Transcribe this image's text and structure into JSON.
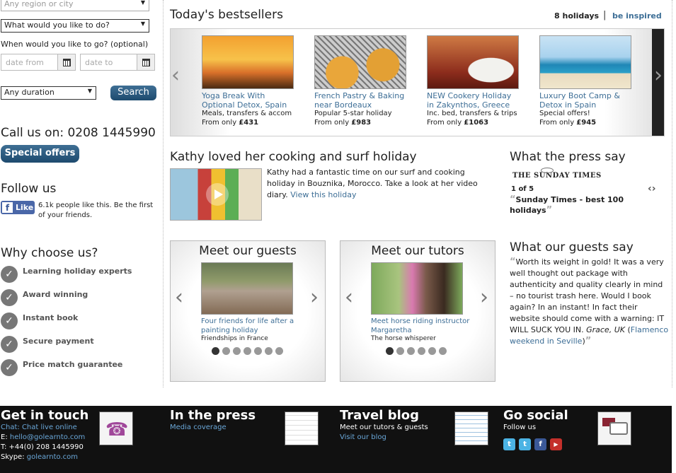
{
  "search": {
    "region_placeholder": "Any region or city",
    "what_label": "What would you like to do?",
    "when_label": "When would you like to go? (optional)",
    "date_from_placeholder": "date from",
    "date_to_placeholder": "date to",
    "duration": "Any duration",
    "search_button": "Search"
  },
  "sidebar": {
    "call_us": "Call us on: 0208 1445990",
    "special_offers": "Special offers",
    "follow_us": "Follow us",
    "like_button": "Like",
    "like_text": "6.1k people like this. Be the first of your friends.",
    "why_title": "Why choose us?",
    "why_items": [
      "Learning holiday experts",
      "Award winning",
      "Instant book",
      "Secure payment",
      "Price match guarantee"
    ]
  },
  "bestsellers": {
    "title": "Today's bestsellers",
    "count": "8 holidays",
    "inspired_link": "be inspired",
    "cards": [
      {
        "title": "Yoga Break With Optional Detox, Spain",
        "desc": "Meals, transfers & accom",
        "price_prefix": "From only ",
        "price": "£431",
        "image": "yoga-photo"
      },
      {
        "title": "French Pastry & Baking near Bordeaux",
        "desc": "Popular 5-star holiday",
        "price_prefix": "From only ",
        "price": "£983",
        "image": "pastry-photo"
      },
      {
        "title": "NEW Cookery Holiday in Zakynthos, Greece",
        "desc": "Inc. bed, transfers & trips",
        "price_prefix": "From only ",
        "price": "£1063",
        "image": "cookery-photo"
      },
      {
        "title": "Luxury Boot Camp & Detox in Spain",
        "desc": "Special offers!",
        "price_prefix": "From only ",
        "price": "£945",
        "image": "bootcamp-photo"
      }
    ]
  },
  "feature": {
    "title": "Kathy loved her cooking and surf holiday",
    "text": "Kathy had a fantastic time on our surf and cooking holiday in Bouznika, Morocco. Take a look at her video diary.",
    "link": "View this holiday"
  },
  "press": {
    "title": "What the press say",
    "logo": "THE SUNDAY TIMES",
    "counter": "1 of 5",
    "quote": "Sunday Times - best 100 holidays"
  },
  "guests": {
    "title": "Meet our guests",
    "link": "Four friends for life after a painting holiday",
    "sub": "Friendships in France"
  },
  "tutors": {
    "title": "Meet our tutors",
    "link": "Meet horse riding instructor Margaretha",
    "sub": "The horse whisperer"
  },
  "testimonial": {
    "title": "What our guests say",
    "text": "Worth its weight in gold! It was a very well thought out package with authenticity and quality clearly in mind – no tourist trash here. Would I book again? In an instant! In fact their website should come with a warning: IT WILL SUCK YOU IN.",
    "author": "Grace, UK",
    "holiday": "Flamenco weekend in Seville"
  },
  "footer": {
    "contact": {
      "title": "Get in touch",
      "chat_label": "Chat:",
      "chat_link": "Chat live online",
      "email_label": "E:",
      "email": "hello@golearnto.com",
      "phone": "T: +44(0) 208 1445990",
      "skype_label": "Skype:",
      "skype": "golearnto.com"
    },
    "press": {
      "title": "In the press",
      "link": "Media coverage"
    },
    "blog": {
      "title": "Travel blog",
      "text": "Meet our tutors & guests",
      "link": "Visit our blog"
    },
    "social": {
      "title": "Go social",
      "text": "Follow us",
      "networks": [
        "twitter-icon",
        "twitter-icon",
        "facebook-icon",
        "youtube-icon"
      ]
    }
  }
}
